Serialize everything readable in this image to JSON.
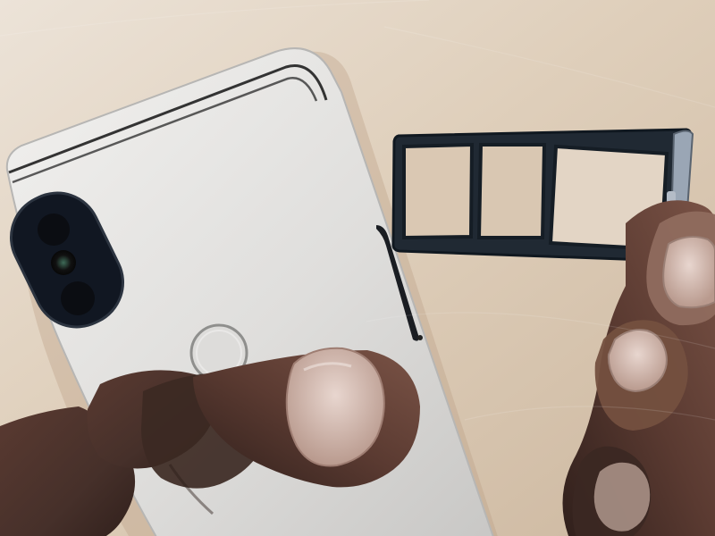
{
  "scene": {
    "kind": "photo",
    "subject": "phone-back-with-sim-tray",
    "colors": {
      "table_light": "#e7dccd",
      "table_mid": "#d7c6b1",
      "table_dark": "#c8b39b",
      "phone_light": "#e9e8e6",
      "phone_mid": "#d8d7d5",
      "phone_dark": "#bdbcba",
      "camera_black": "#131722",
      "tray_dark": "#1d2630",
      "skin_dark": "#4b3129",
      "skin_mid": "#6b463a",
      "nail": "#c3a79d"
    },
    "objects": {
      "phone": "phone-back",
      "sim_tray": "sim-tray",
      "left_hand": "left-hand",
      "right_hand": "right-hand"
    }
  }
}
